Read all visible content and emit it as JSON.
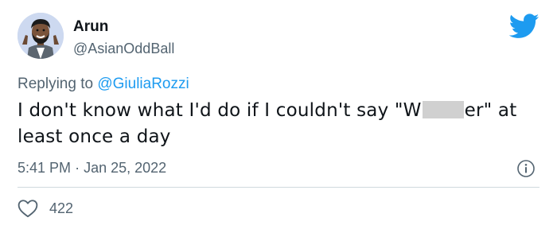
{
  "author": {
    "name": "Arun",
    "handle": "@AsianOddBall"
  },
  "reply": {
    "prefix": "Replying to",
    "mention": "@GiuliaRozzi"
  },
  "tweet": {
    "text_before_redaction": "I don't know what I'd do if I couldn't say \"W",
    "text_after_redaction": "er\" at least once a day"
  },
  "meta": {
    "time": "5:41 PM",
    "separator": "·",
    "date": "Jan 25, 2022"
  },
  "engagement": {
    "likes": "422"
  },
  "colors": {
    "brand": "#1d9bf0",
    "text": "#0f1419",
    "secondary": "#536471",
    "divider": "#cfd9de",
    "redaction": "#d0d0d0"
  },
  "icons": {
    "logo": "twitter-bird-icon",
    "info": "info-icon",
    "like": "heart-icon"
  }
}
